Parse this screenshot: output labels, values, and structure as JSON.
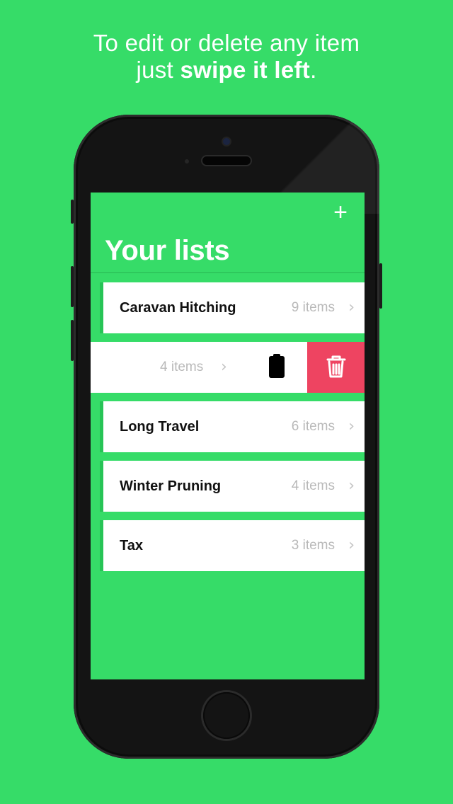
{
  "headline": {
    "line1": "To edit or delete any item",
    "line2_prefix": "just ",
    "line2_bold": "swipe it left",
    "line2_suffix": "."
  },
  "app": {
    "title": "Your lists",
    "add_symbol": "+",
    "chevron": "›",
    "lists": [
      {
        "name": "Caravan Hitching",
        "count": "9 items"
      },
      {
        "name": "",
        "count": "4 items",
        "swiped": true
      },
      {
        "name": "Long Travel",
        "count": "6 items"
      },
      {
        "name": "Winter Pruning",
        "count": "4 items"
      },
      {
        "name": "Tax",
        "count": "3 items"
      }
    ],
    "swipe_actions": {
      "edit_icon": "clipboard-icon",
      "delete_icon": "trash-icon"
    }
  },
  "colors": {
    "background": "#36dc68",
    "row_accent": "#27c456",
    "delete": "#ee4461",
    "count_text": "#b9b9b9"
  }
}
